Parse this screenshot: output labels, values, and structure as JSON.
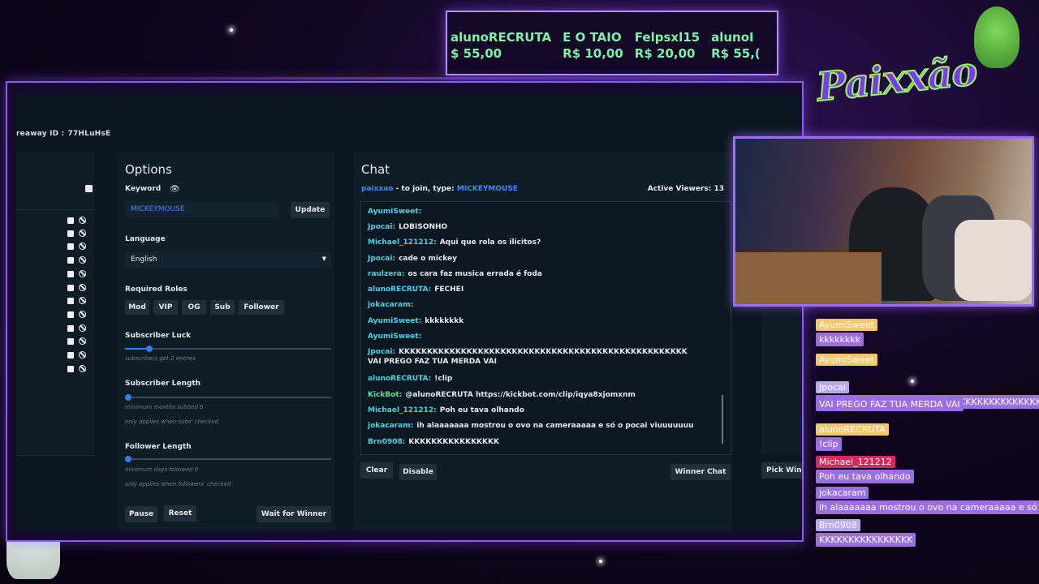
{
  "ticker": {
    "donations": [
      {
        "name": "alunoRECRUTA",
        "amount": "$ 55,00"
      },
      {
        "name": "E O TAIO",
        "amount": "R$ 10,00"
      },
      {
        "name": "Felpsxl15",
        "amount": "R$ 20,00"
      },
      {
        "name": "alunoI",
        "amount": "R$ 55,("
      }
    ]
  },
  "app": {
    "giveaway_id_label": "reaway ID :",
    "giveaway_id_value": "77HLuHsE",
    "options": {
      "title": "Options",
      "keyword_label": "Keyword",
      "keyword_value": "MICKEYMOUSE",
      "update_label": "Update",
      "language_label": "Language",
      "language_value": "English",
      "roles_label": "Required Roles",
      "roles": [
        "Mod",
        "VIP",
        "OG",
        "Sub",
        "Follower"
      ],
      "sub_luck_label": "Subscriber Luck",
      "sub_luck_note": "subscribers get 2 entries",
      "sub_length_label": "Subscriber Length",
      "sub_length_note1": "minimum months subbed 0",
      "sub_length_note2": "only applies when subs' checked",
      "follower_length_label": "Follower Length",
      "follower_length_note1": "minimum days followed 0",
      "follower_length_note2": "only applies when followers' checked",
      "pause_label": "Pause",
      "reset_label": "Reset",
      "wait_label": "Wait for Winner",
      "sub_luck_level": 0.12
    },
    "chat": {
      "title": "Chat",
      "join_user": "paixxao",
      "join_text": " - to join, type: ",
      "join_keyword": "MICKEYMOUSE",
      "active_viewers_label": "Active Viewers: 13",
      "messages": [
        {
          "user": "AyumiSweet:",
          "text": "",
          "color": "cyan"
        },
        {
          "user": "Jpocai:",
          "text": "LOBISONHO",
          "color": "cyan"
        },
        {
          "user": "Michael_121212:",
          "text": "Aqui que rola os ilicitos?",
          "color": "cyan"
        },
        {
          "user": "Jpocai:",
          "text": "cade o mickey",
          "color": "cyan"
        },
        {
          "user": "raulzera:",
          "text": "os cara faz musica errada é foda",
          "color": "cyan"
        },
        {
          "user": "alunoRECRUTA:",
          "text": "FECHEI",
          "color": "cyan"
        },
        {
          "user": "jokacaram:",
          "text": "",
          "color": "cyan"
        },
        {
          "user": "AyumiSweet:",
          "text": "kkkkkkkk",
          "color": "cyan"
        },
        {
          "user": "AyumiSweet:",
          "text": "",
          "color": "cyan"
        },
        {
          "user": "Jpocai:",
          "text": "KKKKKKKKKKKKKKKKKKKKKKKKKKKKKKKKKKKKKKKKKKKKKKKKKKK",
          "color": "cyan"
        },
        {
          "user": "",
          "text": "VAI PREGO FAZ TUA MERDA VAI",
          "color": "cyan"
        },
        {
          "user": "alunoRECRUTA:",
          "text": "!clip",
          "color": "cyan"
        },
        {
          "user": "KickBot:",
          "text": "@alunoRECRUTA https://kickbot.com/clip/iqya8xjomxnm",
          "color": "green"
        },
        {
          "user": "Michael_121212:",
          "text": "Poh eu tava olhando",
          "color": "cyan"
        },
        {
          "user": "jokacaram:",
          "text": "ih alaaaaaaa mostrou o ovo na cameraaaaa e só o pocai viuuuuuuu",
          "color": "cyan"
        },
        {
          "user": "Brn0908:",
          "text": "KKKKKKKKKKKKKKKK",
          "color": "cyan"
        }
      ],
      "clear_label": "Clear",
      "disable_label": "Disable",
      "winner_chat_label": "Winner Chat"
    },
    "pick_winner_label": "Pick Win"
  },
  "logo_text": "Paixxão",
  "overlay_chat": [
    {
      "name": "AyumiSweet",
      "text": "kkkkkkkk",
      "name_bg": "#f5c76b"
    },
    {
      "name": "AyumiSweet",
      "text": "",
      "name_bg": "#f5c76b"
    },
    {
      "name": "Jpocai",
      "text": "KKKKKKKKKKKKKKKKKKKKKKKKKKKKKKKKKKKKKKKKKK",
      "name_bg": "#b8a9f0"
    },
    {
      "name": "",
      "text": "VAI PREGO FAZ TUA MERDA VAI",
      "name_bg": ""
    },
    {
      "name": "alunoRECRUTA",
      "text": "!clip",
      "name_bg": "#f5c76b"
    },
    {
      "name": "Michael_121212",
      "text": "Poh eu tava olhando",
      "name_bg": "#e0245e"
    },
    {
      "name": "jokacaram",
      "text": "ih alaaaaaaa mostrou o ovo na cameraaaaa e só o p",
      "name_bg": "#9b6fe0"
    },
    {
      "name": "Brn0908",
      "text": "KKKKKKKKKKKKKKKK",
      "name_bg": "#b8a9f0"
    }
  ],
  "colors": {
    "accent": "#2f7df6",
    "frame": "#8b5cf6",
    "donation": "#7ef0a8"
  }
}
